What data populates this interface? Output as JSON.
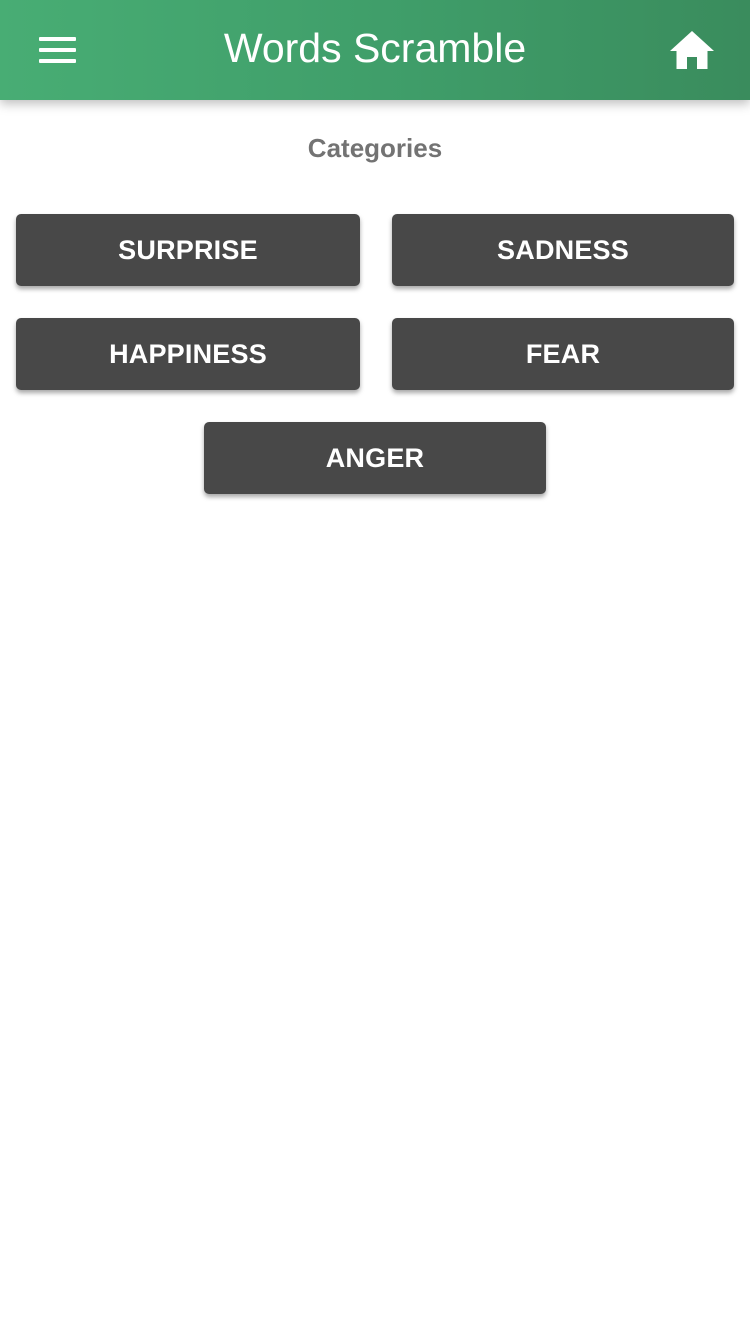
{
  "app_bar": {
    "title": "Words Scramble",
    "menu_icon": "hamburger-menu-icon",
    "home_icon": "home-icon",
    "background_start": "#48ad74",
    "background_end": "#3a8c5d"
  },
  "section": {
    "title": "Categories"
  },
  "categories": [
    {
      "label": "SURPRISE"
    },
    {
      "label": "SADNESS"
    },
    {
      "label": "HAPPINESS"
    },
    {
      "label": "FEAR"
    },
    {
      "label": "ANGER"
    }
  ],
  "colors": {
    "button_background": "#484848",
    "button_text": "#ffffff",
    "section_title": "#737373"
  }
}
